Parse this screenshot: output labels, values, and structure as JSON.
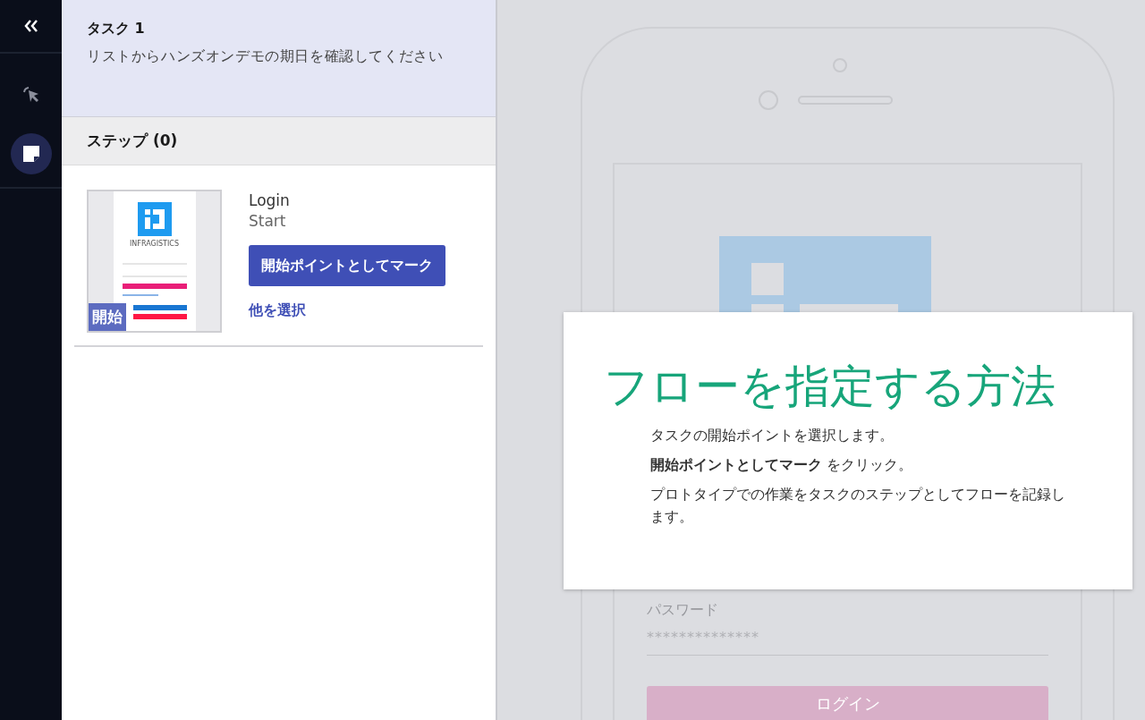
{
  "rail": {
    "tools": [
      {
        "kind": "pointer",
        "selected": false
      },
      {
        "kind": "note",
        "selected": true
      }
    ]
  },
  "task": {
    "title": "タスク 1",
    "description": "リストからハンズオンデモの期日を確認してください"
  },
  "steps": {
    "header": "ステップ (0)",
    "items": [
      {
        "thumbnail_brand": "INFRAGISTICS",
        "badge": "開始",
        "name": "Login",
        "status": "Start",
        "mark_button": "開始ポイントとしてマーク",
        "other_link": "他を選択"
      }
    ]
  },
  "prototype": {
    "password_label": "パスワード",
    "password_value": "**************",
    "login_button": "ログイン"
  },
  "help": {
    "title": "フローを指定する方法",
    "lines": [
      "タスクの開始ポイントを選択します。",
      "**開始ポイントとしてマーク** をクリック。",
      "プロトタイプでの作業をタスクのステップとしてフローを記録します。"
    ]
  }
}
